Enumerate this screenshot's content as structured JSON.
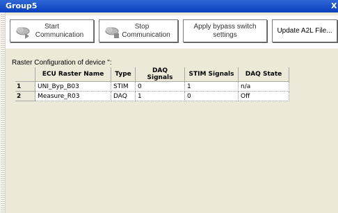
{
  "window": {
    "title": "Group5",
    "close_glyph": "X"
  },
  "toolbar": {
    "start": {
      "line1": "Start",
      "line2": "Communication",
      "icon": "cloud-play-icon"
    },
    "stop": {
      "line1": "Stop",
      "line2": "Communication",
      "icon": "cloud-stop-icon"
    },
    "bypass": {
      "line1": "Apply bypass switch",
      "line2": "settings"
    },
    "update": {
      "label": "Update A2L File..."
    }
  },
  "raster_label": "Raster Configuration of device \":",
  "table": {
    "headers": [
      "ECU Raster Name",
      "Type",
      "DAQ Signals",
      "STIM Signals",
      "DAQ State"
    ],
    "rows": [
      {
        "num": "1",
        "name": "UNI_Byp_B03",
        "type": "STIM",
        "daq": "0",
        "stim": "1",
        "state": "n/a"
      },
      {
        "num": "2",
        "name": "Measure_R03",
        "type": "DAQ",
        "daq": "1",
        "stim": "0",
        "state": "Off"
      }
    ]
  },
  "colors": {
    "titlebar": "#0a3fbf",
    "panel": "#ece9d8"
  }
}
